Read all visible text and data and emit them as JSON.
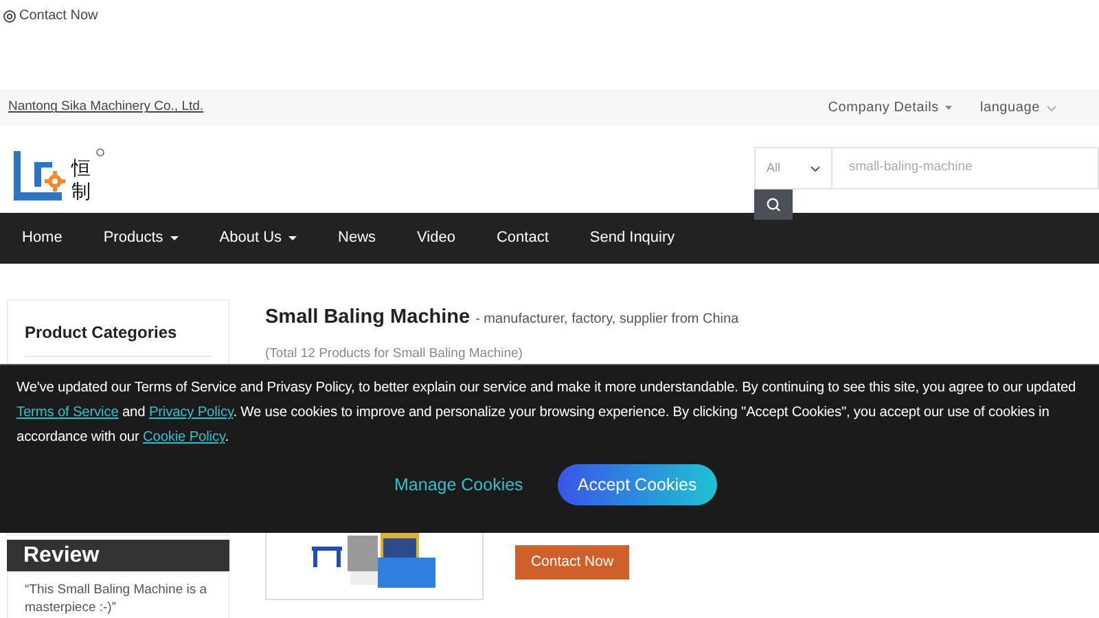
{
  "top_contact": {
    "label": "Contact Now"
  },
  "top_bar": {
    "company": "Nantong Sika Machinery Co., Ltd.",
    "menus": [
      {
        "label": "Company Details",
        "kind": "filled"
      },
      {
        "label": "language",
        "kind": "chevron"
      }
    ]
  },
  "logo": {
    "characters": [
      "恒",
      "制"
    ]
  },
  "search": {
    "scope": "All",
    "placeholder": "small-baling-machine"
  },
  "nav": [
    {
      "label": "Home",
      "dropdown": false
    },
    {
      "label": "Products",
      "dropdown": true
    },
    {
      "label": "About Us",
      "dropdown": true
    },
    {
      "label": "News",
      "dropdown": false
    },
    {
      "label": "Video",
      "dropdown": false
    },
    {
      "label": "Contact",
      "dropdown": false
    },
    {
      "label": "Send Inquiry",
      "dropdown": false
    }
  ],
  "sidebar": {
    "title": "Product Categories",
    "review_title": "Review",
    "review_text": "“This Small Baling Machine is a masterpiece :-)”"
  },
  "listing": {
    "title": "Small Baling Machine",
    "subtitle": "- manufacturer, factory, supplier from China",
    "total": "(Total 12 Products for Small Baling Machine)",
    "contact_button": "Contact Now"
  },
  "cookie_banner": {
    "text": [
      {
        "kind": "text",
        "text": "We've updated our Terms of Service and Privasy Policy, to better explain our service and make it more understandable. By continuing to see this site, you agree to our updated "
      },
      {
        "kind": "link",
        "text": "Terms of Service"
      },
      {
        "kind": "text",
        "text": " and "
      },
      {
        "kind": "link",
        "text": "Privacy Policy"
      },
      {
        "kind": "text",
        "text": ". We use cookies to improve and personalize your browsing experience. By clicking \"Accept Cookies\", you accept our use of cookies in accordance with our "
      },
      {
        "kind": "link",
        "text": "Cookie Policy"
      },
      {
        "kind": "text",
        "text": "."
      }
    ],
    "buttons": [
      {
        "label": "Manage Cookies",
        "kind": "link"
      },
      {
        "label": "Accept Cookies",
        "kind": "primary"
      }
    ]
  }
}
